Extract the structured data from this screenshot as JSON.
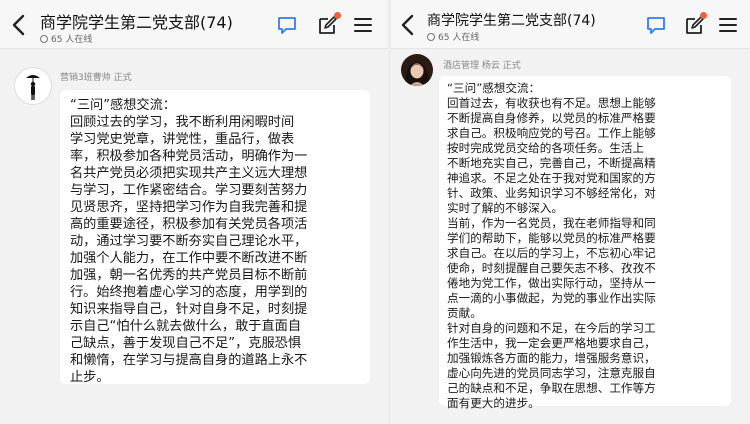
{
  "header": {
    "title": "商学院学生第二党支部(74)",
    "online": "65 人在线"
  },
  "colors": {
    "accent": "#2f7df6",
    "badge": "#e8623a",
    "bubble": "#ffffff",
    "background": "#f2f2f2"
  },
  "icons": {
    "back": "back-arrow-icon",
    "chat": "chat-icon",
    "edit": "edit-icon",
    "menu": "menu-icon",
    "online": "online-indicator-icon"
  },
  "messages": [
    {
      "sender": "营销3班曹帅  正式",
      "lines": [
        "“三问”感想交流：",
        "  回顾过去的学习，我不断利用闲暇时间",
        "学习党史党章，讲党性，重品行，做表",
        "率，积极参加各种党员活动，明确作为一",
        "名共产党员必须把实现共产主义远大理想",
        "与学习，工作紧密结合。学习要刻苦努力",
        "见贤思齐，坚持把学习作为自我完善和提",
        "高的重要途径，积极参加有关党员各项活",
        "动，通过学习要不断夯实自己理论水平，",
        "加强个人能力，在工作中要不断改进不断",
        "加强，朝一名优秀的共产党员目标不断前",
        "行。始终抱着虚心学习的态度，用学到的",
        "知识来指导自己，针对自身不足，时刻提",
        "示自己“怕什么就去做什么，敢于直面自",
        "己缺点，善于发现自己不足”，克服恐惧",
        "和懒惰，在学习与提高自身的道路上永不",
        "止步。"
      ]
    },
    {
      "sender": "酒店管理 杨云  正式",
      "lines": [
        "“三问”感想交流：",
        "回首过去，有收获也有不足。思想上能够",
        "不断提高自身修养，以党员的标准严格要",
        "求自己。积极响应党的号召。工作上能够",
        "按时完成党员交给的各项任务。生活上",
        "不断地充实自己，完善自己，不断提高精",
        "神追求。不足之处在于我对党和国家的方",
        "针、政策、业务知识学习不够经常化，对",
        "实时了解的不够深入。",
        "当前，作为一名党员，我在老师指导和同",
        "学们的帮助下，能够以党员的标准严格要",
        "求自己。在以后的学习上，不忘初心牢记",
        "使命，时刻提醒自己要矢志不移、孜孜不",
        "倦地为党工作，做出实际行动，坚持从一",
        "点一滴的小事做起，为党的事业作出实际",
        "贡献。",
        "针对自身的问题和不足，在今后的学习工",
        "作生活中，我一定会更严格地要求自己，",
        "加强锻炼各方面的能力，增强服务意识，",
        "虚心向先进的党员同志学习，注意克服自",
        "己的缺点和不足，争取在思想、工作等方",
        "面有更大的进步。"
      ]
    }
  ]
}
